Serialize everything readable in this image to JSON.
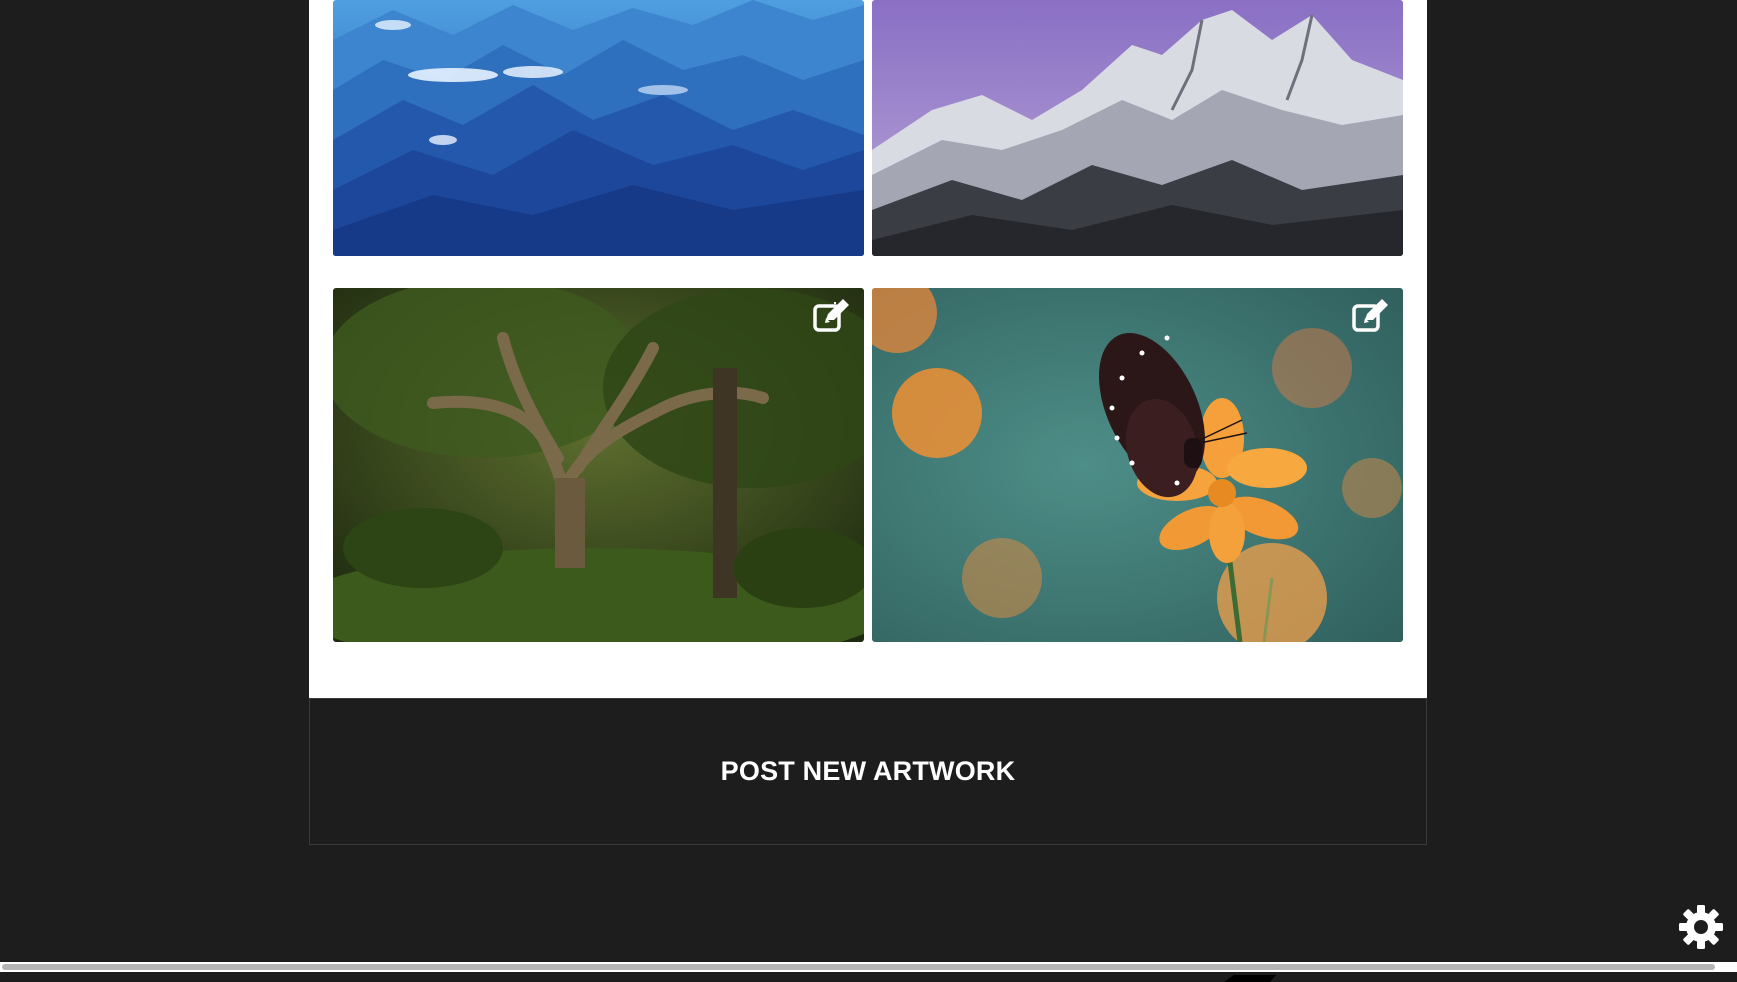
{
  "gallery": {
    "artworks": [
      {
        "subject": "blue mountain range above clouds",
        "editable": false
      },
      {
        "subject": "snowy mountain peaks under purple sky",
        "editable": false
      },
      {
        "subject": "large tree in green forest",
        "editable": true,
        "edit_icon": "edit-icon"
      },
      {
        "subject": "butterfly on orange flower",
        "editable": true,
        "edit_icon": "edit-icon"
      }
    ]
  },
  "actions": {
    "post_label": "POST NEW ARTWORK"
  },
  "settings": {
    "icon": "gear-icon"
  },
  "colors": {
    "page_background": "#1e1d1d",
    "panel_background": "#ffffff",
    "button_text": "#ffffff"
  }
}
